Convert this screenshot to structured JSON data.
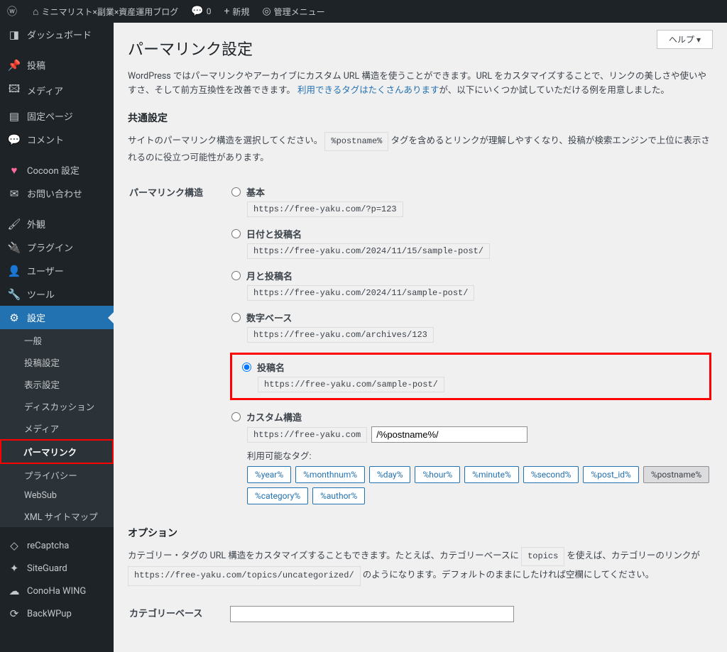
{
  "adminbar": {
    "site": "ミニマリスト×副業×資産運用ブログ",
    "comments": "0",
    "new": "新規",
    "admin_menu": "管理メニュー"
  },
  "sidebar": {
    "dashboard": "ダッシュボード",
    "posts": "投稿",
    "media": "メディア",
    "pages": "固定ページ",
    "comments": "コメント",
    "cocoon": "Cocoon 設定",
    "contact": "お問い合わせ",
    "appearance": "外観",
    "plugins": "プラグイン",
    "users": "ユーザー",
    "tools": "ツール",
    "settings": "設定",
    "sub": {
      "general": "一般",
      "writing": "投稿設定",
      "reading": "表示設定",
      "discussion": "ディスカッション",
      "media": "メディア",
      "permalink": "パーマリンク",
      "privacy": "プライバシー",
      "websub": "WebSub",
      "xml": "XML サイトマップ"
    },
    "recaptcha": "reCaptcha",
    "siteguard": "SiteGuard",
    "conoha": "ConoHa WING",
    "backwpup": "BackWPup"
  },
  "helpTab": "ヘルプ ▾",
  "page": {
    "title": "パーマリンク設定",
    "intro_a": "WordPress ではパーマリンクやアーカイブにカスタム URL 構造を使うことができます。URL をカスタマイズすることで、リンクの美しさや使いやすさ、そして前方互換性を改善できます。",
    "intro_link": "利用できるタグはたくさんあります",
    "intro_b": "が、以下にいくつか試していただける例を用意しました。",
    "common_h": "共通設定",
    "common_desc_a": "サイトのパーマリンク構造を選択してください。",
    "common_desc_b": "タグを含めるとリンクが理解しやすくなり、投稿が検索エンジンで上位に表示されるのに役立つ可能性があります。",
    "structure_label": "パーマリンク構造",
    "opts": {
      "plain": {
        "label": "基本",
        "ex": "https://free-yaku.com/?p=123"
      },
      "day": {
        "label": "日付と投稿名",
        "ex": "https://free-yaku.com/2024/11/15/sample-post/"
      },
      "month": {
        "label": "月と投稿名",
        "ex": "https://free-yaku.com/2024/11/sample-post/"
      },
      "numeric": {
        "label": "数字ベース",
        "ex": "https://free-yaku.com/archives/123"
      },
      "postname": {
        "label": "投稿名",
        "ex": "https://free-yaku.com/sample-post/"
      },
      "custom": {
        "label": "カスタム構造",
        "base": "https://free-yaku.com",
        "value": "/%postname%/"
      }
    },
    "tags_label": "利用可能なタグ:",
    "tags": [
      "%year%",
      "%monthnum%",
      "%day%",
      "%hour%",
      "%minute%",
      "%second%",
      "%post_id%",
      "%postname%",
      "%category%",
      "%author%"
    ],
    "options_h": "オプション",
    "options_desc_a": "カテゴリー・タグの URL 構造をカスタマイズすることもできます。たとえば、カテゴリーベースに ",
    "options_topics": "topics",
    "options_desc_b": " を使えば、カテゴリーのリンクが ",
    "options_example": "https://free-yaku.com/topics/uncategorized/",
    "options_desc_c": " のようになります。デフォルトのままにしたければ空欄にしてください。",
    "category_base": "カテゴリーベース"
  }
}
